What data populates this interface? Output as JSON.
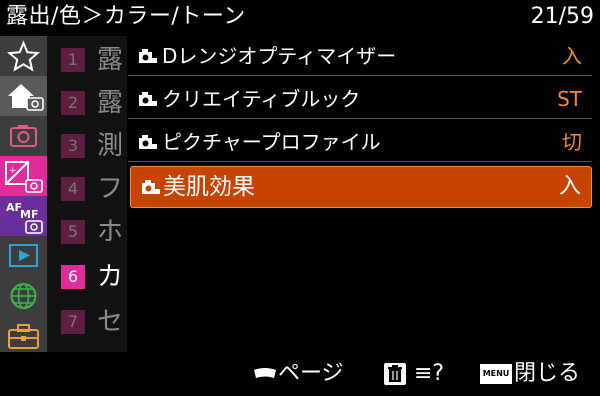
{
  "header": {
    "title": "露出/色＞カラー/トーン",
    "page_indicator": "21/59"
  },
  "sidebar": {
    "icons": [
      {
        "name": "favorites-star-icon"
      },
      {
        "name": "home-shooting-icon"
      },
      {
        "name": "shooting-camera-icon"
      },
      {
        "name": "exposure-color-icon"
      },
      {
        "name": "af-mf-focus-icon"
      },
      {
        "name": "playback-icon"
      },
      {
        "name": "network-icon"
      },
      {
        "name": "setup-toolbox-icon"
      }
    ]
  },
  "pages": [
    {
      "num": "1",
      "char": "露"
    },
    {
      "num": "2",
      "char": "露"
    },
    {
      "num": "3",
      "char": "測"
    },
    {
      "num": "4",
      "char": "フ"
    },
    {
      "num": "5",
      "char": "ホ"
    },
    {
      "num": "6",
      "char": "カ"
    },
    {
      "num": "7",
      "char": "セ"
    }
  ],
  "menu": {
    "items": [
      {
        "label": "Dレンジオプティマイザー",
        "value": "入"
      },
      {
        "label": "クリエイティブルック",
        "value": "ST"
      },
      {
        "label": "ピクチャープロファイル",
        "value": "切"
      },
      {
        "label": "美肌効果",
        "value": "入"
      }
    ]
  },
  "footer": {
    "page_label": "ページ",
    "delete_help_label": "≡?",
    "menu_key": "MENU",
    "close_label": "閉じる"
  },
  "colors": {
    "accent_orange": "#f08a2c",
    "selected_bg": "#c64400",
    "current_page_pink": "#e12b9a",
    "page_box_dark": "#5e1e40"
  }
}
